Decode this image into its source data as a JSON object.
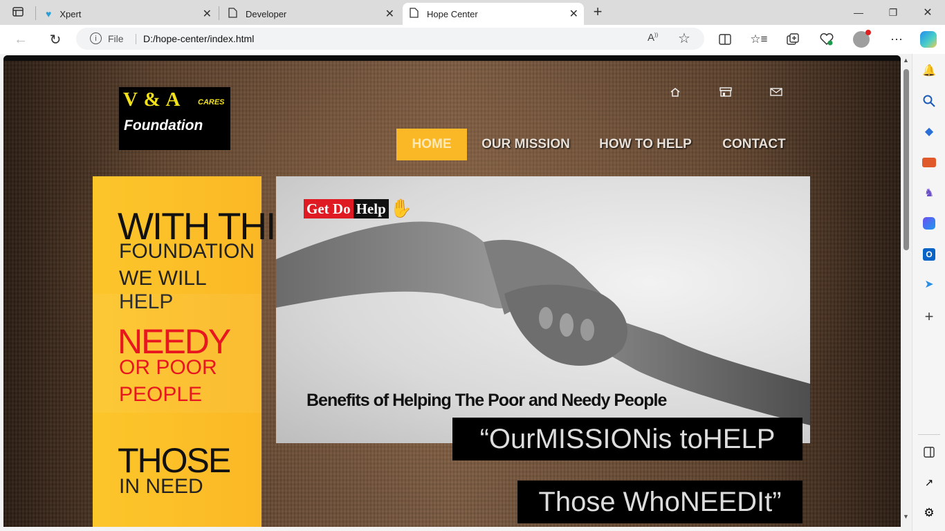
{
  "browser": {
    "tabs": [
      {
        "title": "Xpert"
      },
      {
        "title": "Developer"
      },
      {
        "title": "Hope Center"
      }
    ],
    "address": {
      "scheme_label": "File",
      "url": "D:/hope-center/index.html"
    }
  },
  "site": {
    "logo": {
      "line1": "V & A",
      "line1_small": "CARES",
      "line2": "Foundation"
    },
    "nav": [
      "HOME",
      "OUR MISSION",
      "HOW TO HELP",
      "CONTACT"
    ],
    "left_panel": {
      "b1": {
        "big": "WITH THIS",
        "line2": "FOUNDATION",
        "line3": "WE WILL HELP"
      },
      "b2": {
        "big": "NEEDY",
        "line2": "OR POOR",
        "line3": "PEOPLE"
      },
      "b3": {
        "big": "THOSE",
        "line2": "IN NEED"
      }
    },
    "hero": {
      "badge_red": "Get Do",
      "badge_black": "Help",
      "caption": "Benefits of Helping The Poor and Needy People"
    },
    "quote1": "“OurMISSIONis toHELP",
    "quote2": "Those WhoNEEDIt”"
  },
  "colors": {
    "accent": "#fbb826",
    "needy_red": "#e8171f"
  }
}
